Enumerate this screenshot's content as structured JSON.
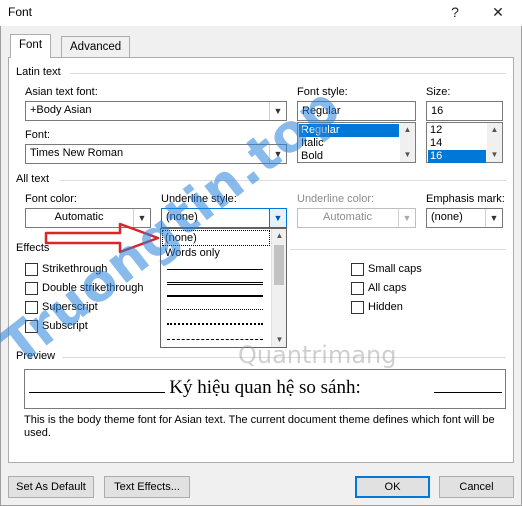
{
  "window": {
    "title": "Font",
    "help_glyph": "?",
    "close_glyph": "✕"
  },
  "tabs": [
    {
      "label": "Font",
      "accel": "n",
      "active": true
    },
    {
      "label": "Advanced",
      "accel": "v",
      "active": false
    }
  ],
  "latin_text": {
    "group_label": "Latin text",
    "asian_font_label": "Asian text font:",
    "asian_font_value": "+Body Asian",
    "font_label": "Font:",
    "font_value": "Times New Roman",
    "style_label": "Font style:",
    "style_value": "Regular",
    "style_options": [
      "Regular",
      "Italic",
      "Bold"
    ],
    "style_selected": "Regular",
    "size_label": "Size:",
    "size_value": "16",
    "size_options": [
      "12",
      "14",
      "16"
    ],
    "size_selected": "16"
  },
  "all_text": {
    "group_label": "All text",
    "font_color_label": "Font color:",
    "font_color_value": "Automatic",
    "underline_style_label": "Underline style:",
    "underline_style_value": "(none)",
    "underline_color_label": "Underline color:",
    "underline_color_value": "Automatic",
    "emphasis_label": "Emphasis mark:",
    "emphasis_value": "(none)"
  },
  "underline_dropdown": {
    "items": [
      "(none)",
      "Words only"
    ],
    "selected": "(none)"
  },
  "effects": {
    "group_label": "Effects",
    "left": [
      "Strikethrough",
      "Double strikethrough",
      "Superscript",
      "Subscript"
    ],
    "right": [
      "Small caps",
      "All caps",
      "Hidden"
    ]
  },
  "preview": {
    "group_label": "Preview",
    "sample_text": "Ký hiệu quan hệ so sánh:",
    "description": "This is the body theme font for Asian text. The current document theme defines which font will be used."
  },
  "buttons": {
    "set_default": "Set As Default",
    "text_effects": "Text Effects...",
    "ok": "OK",
    "cancel": "Cancel"
  },
  "watermarks": {
    "brand_main": "Truongtin.top",
    "brand_secondary": "Quantrimang"
  },
  "colors": {
    "selection": "#0078d7",
    "arrow": "#d9262b",
    "watermark_blue": "#2882dc"
  }
}
